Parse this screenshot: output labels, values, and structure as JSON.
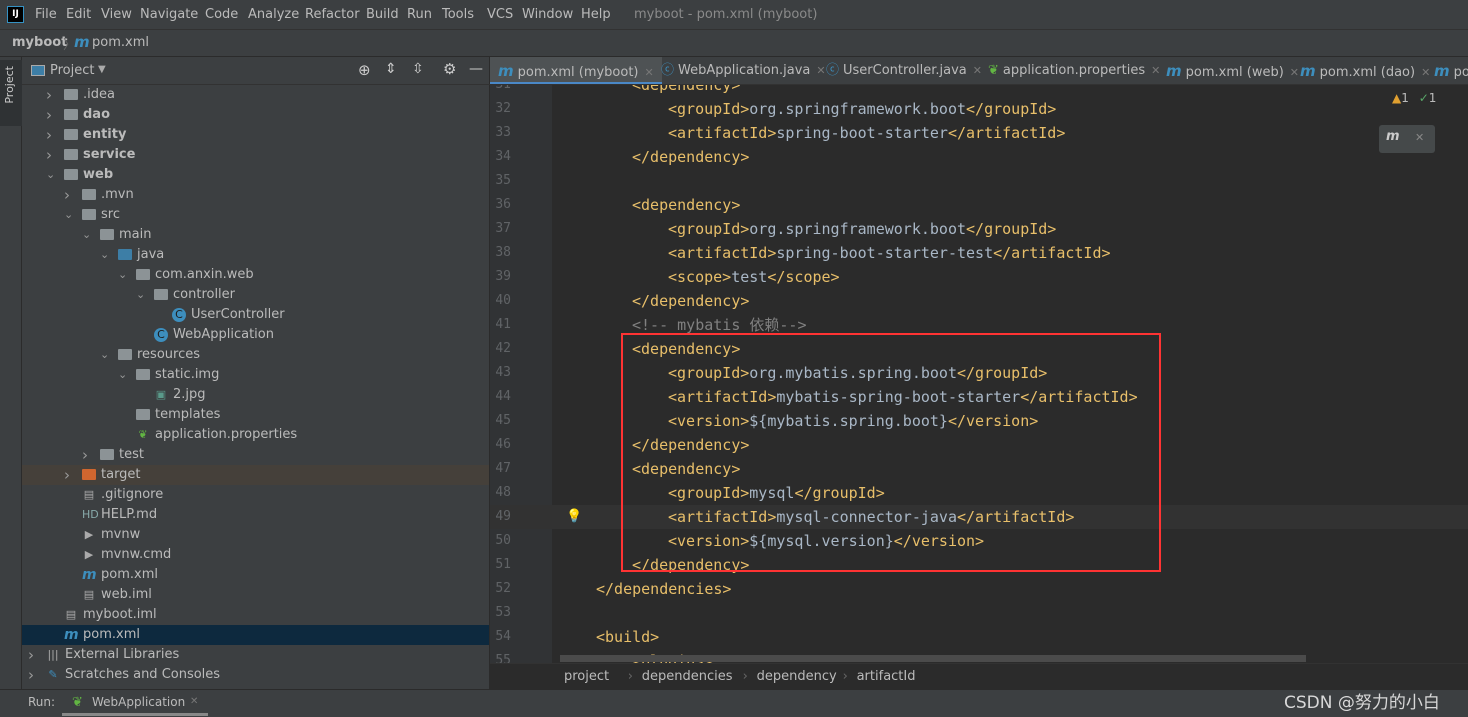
{
  "app": {
    "logo": "IJ",
    "window_title": "myboot - pom.xml (myboot)"
  },
  "menu": [
    "File",
    "Edit",
    "View",
    "Navigate",
    "Code",
    "Analyze",
    "Refactor",
    "Build",
    "Run",
    "Tools",
    "VCS",
    "Window",
    "Help"
  ],
  "navbar": {
    "project": "myboot",
    "file": "pom.xml",
    "maven_icon": "m"
  },
  "left_stripe": {
    "label": "Project"
  },
  "project_panel": {
    "title": "Project",
    "tools": [
      "locate-icon",
      "expand-all-icon",
      "collapse-all-icon",
      "gear-icon",
      "minimize-icon"
    ],
    "tree": [
      {
        "label": ".idea",
        "level": 0,
        "arrow": "right",
        "icon": "folder"
      },
      {
        "label": "dao",
        "level": 0,
        "arrow": "right",
        "icon": "module",
        "bold": true
      },
      {
        "label": "entity",
        "level": 0,
        "arrow": "right",
        "icon": "module",
        "bold": true
      },
      {
        "label": "service",
        "level": 0,
        "arrow": "right",
        "icon": "module",
        "bold": true
      },
      {
        "label": "web",
        "level": 0,
        "arrow": "down",
        "icon": "module",
        "bold": true
      },
      {
        "label": ".mvn",
        "level": 1,
        "arrow": "right",
        "icon": "folder"
      },
      {
        "label": "src",
        "level": 1,
        "arrow": "down",
        "icon": "folder"
      },
      {
        "label": "main",
        "level": 2,
        "arrow": "down",
        "icon": "folder"
      },
      {
        "label": "java",
        "level": 3,
        "arrow": "down",
        "icon": "source-folder"
      },
      {
        "label": "com.anxin.web",
        "level": 4,
        "arrow": "down",
        "icon": "package"
      },
      {
        "label": "controller",
        "level": 5,
        "arrow": "down",
        "icon": "package"
      },
      {
        "label": "UserController",
        "level": 6,
        "icon": "class"
      },
      {
        "label": "WebApplication",
        "level": 5,
        "icon": "spring-class"
      },
      {
        "label": "resources",
        "level": 3,
        "arrow": "down",
        "icon": "resources-folder"
      },
      {
        "label": "static.img",
        "level": 4,
        "arrow": "down",
        "icon": "folder"
      },
      {
        "label": "2.jpg",
        "level": 5,
        "icon": "image"
      },
      {
        "label": "templates",
        "level": 4,
        "icon": "folder"
      },
      {
        "label": "application.properties",
        "level": 4,
        "icon": "spring-properties"
      },
      {
        "label": "test",
        "level": 2,
        "arrow": "right",
        "icon": "folder"
      },
      {
        "label": "target",
        "level": 1,
        "arrow": "right",
        "icon": "excluded-folder",
        "highlight": true
      },
      {
        "label": ".gitignore",
        "level": 1,
        "icon": "file"
      },
      {
        "label": "HELP.md",
        "level": 1,
        "icon": "markdown"
      },
      {
        "label": "mvnw",
        "level": 1,
        "icon": "shell"
      },
      {
        "label": "mvnw.cmd",
        "level": 1,
        "icon": "shell"
      },
      {
        "label": "pom.xml",
        "level": 1,
        "icon": "maven"
      },
      {
        "label": "web.iml",
        "level": 1,
        "icon": "file"
      },
      {
        "label": "myboot.iml",
        "level": 0,
        "icon": "file"
      },
      {
        "label": "pom.xml",
        "level": 0,
        "icon": "maven",
        "selected": true
      },
      {
        "label": "External Libraries",
        "level": -1,
        "arrow": "right",
        "icon": "libraries"
      },
      {
        "label": "Scratches and Consoles",
        "level": -1,
        "arrow": "right",
        "icon": "scratches"
      }
    ]
  },
  "tabs": [
    {
      "label": "pom.xml (myboot)",
      "icon": "maven",
      "active": true
    },
    {
      "label": "WebApplication.java",
      "icon": "spring-class"
    },
    {
      "label": "UserController.java",
      "icon": "class"
    },
    {
      "label": "application.properties",
      "icon": "spring-properties"
    },
    {
      "label": "pom.xml (web)",
      "icon": "maven"
    },
    {
      "label": "pom.xml (dao)",
      "icon": "maven"
    },
    {
      "label": "po",
      "icon": "maven"
    }
  ],
  "inspections": {
    "warnings": "1",
    "ok": "1"
  },
  "code": [
    {
      "n": "31",
      "indent": 2,
      "text": "<dependency>"
    },
    {
      "n": "32",
      "indent": 3,
      "text": "<groupId>org.springframework.boot</groupId>"
    },
    {
      "n": "33",
      "indent": 3,
      "text": "<artifactId>spring-boot-starter</artifactId>"
    },
    {
      "n": "34",
      "indent": 2,
      "text": "</dependency>"
    },
    {
      "n": "35",
      "indent": 0,
      "text": ""
    },
    {
      "n": "36",
      "indent": 2,
      "text": "<dependency>"
    },
    {
      "n": "37",
      "indent": 3,
      "text": "<groupId>org.springframework.boot</groupId>"
    },
    {
      "n": "38",
      "indent": 3,
      "text": "<artifactId>spring-boot-starter-test</artifactId>"
    },
    {
      "n": "39",
      "indent": 3,
      "text": "<scope>test</scope>"
    },
    {
      "n": "40",
      "indent": 2,
      "text": "</dependency>"
    },
    {
      "n": "41",
      "indent": 2,
      "text": "<!-- mybatis 依赖-->",
      "comment": true
    },
    {
      "n": "42",
      "indent": 2,
      "text": "<dependency>"
    },
    {
      "n": "43",
      "indent": 3,
      "text": "<groupId>org.mybatis.spring.boot</groupId>"
    },
    {
      "n": "44",
      "indent": 3,
      "text": "<artifactId>mybatis-spring-boot-starter</artifactId>"
    },
    {
      "n": "45",
      "indent": 3,
      "text": "<version>${mybatis.spring.boot}</version>"
    },
    {
      "n": "46",
      "indent": 2,
      "text": "</dependency>"
    },
    {
      "n": "47",
      "indent": 2,
      "text": "<dependency>"
    },
    {
      "n": "48",
      "indent": 3,
      "text": "<groupId>mysql</groupId>"
    },
    {
      "n": "49",
      "indent": 3,
      "text": "<artifactId>mysql-connector-java</artifactId>",
      "current": true
    },
    {
      "n": "50",
      "indent": 3,
      "text": "<version>${mysql.version}</version>"
    },
    {
      "n": "51",
      "indent": 2,
      "text": "</dependency>"
    },
    {
      "n": "52",
      "indent": 1,
      "text": "</dependencies>"
    },
    {
      "n": "53",
      "indent": 0,
      "text": ""
    },
    {
      "n": "54",
      "indent": 1,
      "text": "<build>"
    },
    {
      "n": "55",
      "indent": 2,
      "text": "<plugins>"
    }
  ],
  "breadcrumbs": [
    "project",
    "dependencies",
    "dependency",
    "artifactId"
  ],
  "run": {
    "label": "Run:",
    "config": "WebApplication"
  },
  "watermark": "CSDN @努力的小白",
  "colors": {
    "editor_bg": "#2b2b2b",
    "tag": "#e8bf6a",
    "text": "#a9b7c6",
    "highlight_box": "#ff3333",
    "selection": "#0d293e"
  }
}
